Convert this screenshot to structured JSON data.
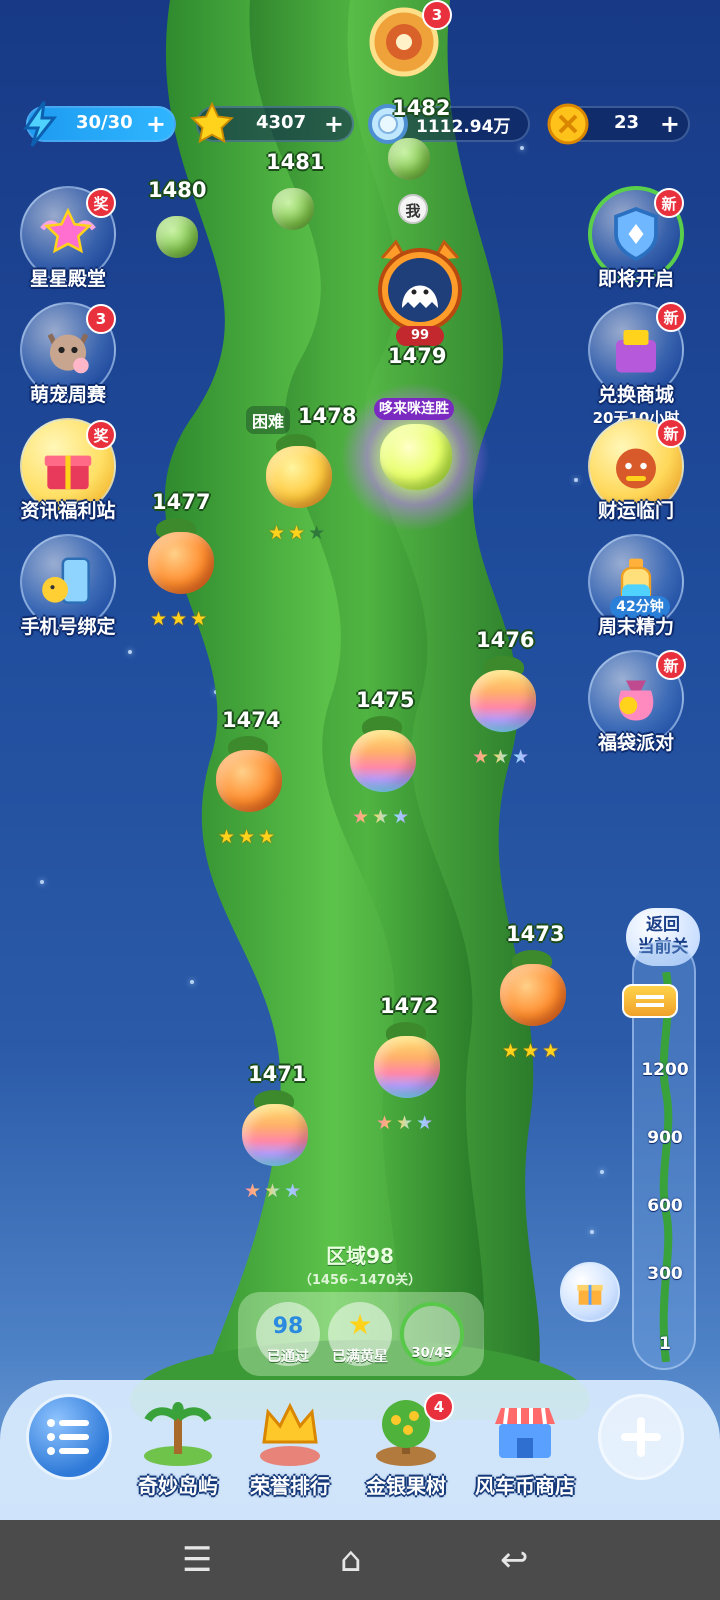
{
  "resources": {
    "energy": {
      "icon": "lightning-icon",
      "value": "30/30"
    },
    "stars": {
      "icon": "star-icon",
      "value": "4307"
    },
    "pearls": {
      "icon": "pearl-icon",
      "value": "1112.94万"
    },
    "coins": {
      "icon": "coin-icon",
      "value": "23"
    },
    "plus": "+"
  },
  "top_event": {
    "icon": "compass-wheel-icon",
    "badge": "3"
  },
  "left_buttons": [
    {
      "label": "星星殿堂",
      "icon": "star-wings-icon",
      "badge": "奖"
    },
    {
      "label": "萌宠周赛",
      "icon": "cat-icon",
      "badge": "3"
    },
    {
      "label": "资讯福利站",
      "icon": "gift-box-icon",
      "badge": "奖"
    },
    {
      "label": "手机号绑定",
      "icon": "phone-chick-icon",
      "badge": ""
    }
  ],
  "right_buttons": [
    {
      "label": "即将开启",
      "sublabel": "",
      "icon": "shield-pinwheel-icon",
      "badge": "新"
    },
    {
      "label": "兑换商城",
      "sublabel": "20天10小时",
      "icon": "shop-bag-icon",
      "badge": "新"
    },
    {
      "label": "财运临门",
      "sublabel": "",
      "icon": "lion-dance-icon",
      "badge": "新"
    },
    {
      "label": "周末精力",
      "sublabel": "",
      "icon": "energy-bottle-icon",
      "badge": "",
      "timer": "42分钟"
    },
    {
      "label": "福袋派对",
      "sublabel": "",
      "icon": "lucky-bag-icon",
      "badge": "新"
    }
  ],
  "player": {
    "marker": "我",
    "level": "99",
    "avatar_icon": "ghost-cat-avatar-icon"
  },
  "levels": [
    {
      "num": "1482",
      "stars": 0
    },
    {
      "num": "1481",
      "stars": 0
    },
    {
      "num": "1480",
      "stars": 0
    },
    {
      "num": "1479",
      "event": "哆来咪连胜",
      "current": true
    },
    {
      "num": "1478",
      "difficulty": "困难",
      "stars": 2
    },
    {
      "num": "1477",
      "stars": 3
    },
    {
      "num": "1476",
      "stars": 3
    },
    {
      "num": "1475",
      "stars": 3
    },
    {
      "num": "1474",
      "stars": 3
    },
    {
      "num": "1473",
      "stars": 3
    },
    {
      "num": "1472",
      "stars": 3
    },
    {
      "num": "1471",
      "stars": 3
    }
  ],
  "area": {
    "title": "区域98",
    "range": "（1456~1470关）",
    "passed_value": "98",
    "passed_label": "已通过",
    "fullstar_label": "已满黄星",
    "progress": "30/45"
  },
  "slider": {
    "return_label_1": "返回",
    "return_label_2": "当前关",
    "ticks": [
      "1200",
      "900",
      "600",
      "300",
      "1"
    ]
  },
  "bottom_nav": [
    {
      "label": "奇妙岛屿",
      "icon": "island-palm-icon",
      "badge": ""
    },
    {
      "label": "荣誉排行",
      "icon": "crown-icon",
      "badge": ""
    },
    {
      "label": "金银果树",
      "icon": "fruit-tree-icon",
      "badge": "4"
    },
    {
      "label": "风车币商店",
      "icon": "shop-stall-icon",
      "badge": ""
    }
  ],
  "colors": {
    "sky_top": "#183a86",
    "stalk_green": "#3f9a3a",
    "badge_red": "#e8313d",
    "energy_blue": "#2fb6ff",
    "star_gold": "#ffd21c"
  }
}
